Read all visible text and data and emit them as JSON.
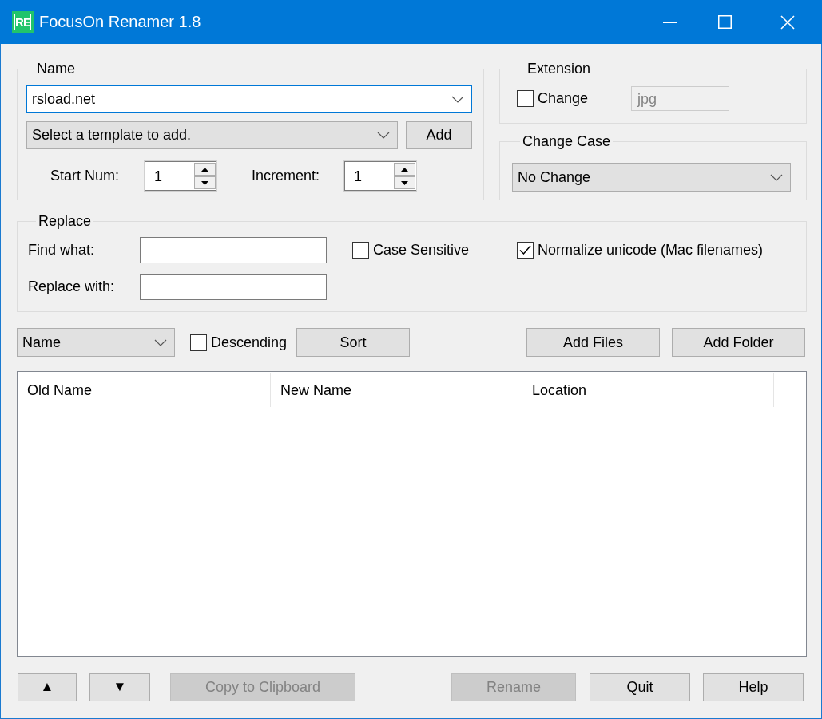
{
  "window": {
    "title": "FocusOn Renamer 1.8",
    "icon_text": "RE"
  },
  "name_group": {
    "label": "Name",
    "name_field": {
      "value": "rsload.net",
      "focused": true
    },
    "template_dropdown": {
      "value": "Select a template to add."
    },
    "add_button": {
      "label": "Add"
    },
    "spinners": [
      {
        "label": "Start Num:",
        "value": "1"
      },
      {
        "label": "Increment:",
        "value": "1"
      }
    ]
  },
  "extension_group": {
    "label": "Extension",
    "change": {
      "label": "Change",
      "checked": false
    },
    "extension_field": {
      "value": "jpg",
      "disabled": true
    }
  },
  "change_case_group": {
    "label": "Change Case",
    "case_dropdown": {
      "value": "No Change"
    }
  },
  "replace_group": {
    "label": "Replace",
    "fields": [
      {
        "label": "Find what:"
      },
      {
        "label": "Replace with:"
      }
    ],
    "options": [
      {
        "label": "Case Sensitive",
        "checked": false
      },
      {
        "label": "Normalize unicode (Mac filenames)",
        "checked": true
      }
    ]
  },
  "sort_bar": {
    "sort_dropdown": {
      "value": "Name"
    },
    "descending": {
      "label": "Descending",
      "checked": false
    },
    "sort_button": {
      "label": "Sort"
    },
    "add_buttons": [
      {
        "label": "Add Files"
      },
      {
        "label": "Add Folder"
      }
    ]
  },
  "file_list": {
    "columns": [
      "Old Name",
      "New Name",
      "Location"
    ]
  },
  "bottom_left": [
    {
      "kind": "arrow",
      "label": "▲",
      "disabled": false
    },
    {
      "kind": "arrow",
      "label": "▼",
      "disabled": false
    },
    {
      "kind": "text",
      "label": "Copy to Clipboard",
      "disabled": true
    }
  ],
  "bottom_right": [
    {
      "label": "Rename",
      "disabled": true
    },
    {
      "label": "Quit",
      "disabled": false
    },
    {
      "label": "Help",
      "disabled": false
    }
  ]
}
